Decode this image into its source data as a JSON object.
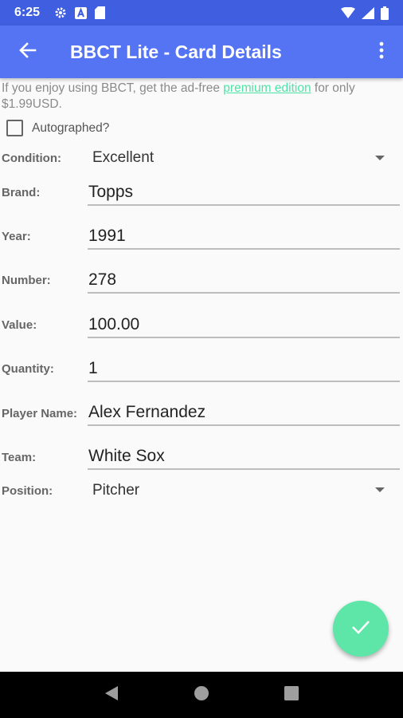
{
  "status_bar": {
    "time": "6:25",
    "left_icons": [
      "settings-icon",
      "a-badge-icon",
      "sd-card-icon"
    ],
    "right_icons": [
      "wifi-icon",
      "signal-icon",
      "battery-icon"
    ]
  },
  "app_bar": {
    "title": "BBCT Lite - Card Details",
    "color": "#5474f4"
  },
  "promo": {
    "text_before": "If you enjoy using BBCT, get the ad-free ",
    "link_text": "premium edition",
    "text_after": " for only $1.99USD.",
    "link_color": "#4fe3a8"
  },
  "autographed": {
    "label": "Autographed?",
    "checked": false
  },
  "fields": {
    "condition": {
      "label": "Condition:",
      "value": "Excellent"
    },
    "brand": {
      "label": "Brand:",
      "value": "Topps"
    },
    "year": {
      "label": "Year:",
      "value": "1991"
    },
    "number": {
      "label": "Number:",
      "value": "278"
    },
    "value": {
      "label": "Value:",
      "value": "100.00"
    },
    "quantity": {
      "label": "Quantity:",
      "value": "1"
    },
    "player_name": {
      "label": "Player Name:",
      "value": "Alex Fernandez"
    },
    "team": {
      "label": "Team:",
      "value": "White Sox"
    },
    "position": {
      "label": "Position:",
      "value": "Pitcher"
    }
  },
  "fab": {
    "icon": "check-icon",
    "color": "#5ee6a8"
  },
  "nav_bar": {
    "icons": [
      "back-triangle-icon",
      "home-circle-icon",
      "recents-square-icon"
    ]
  }
}
